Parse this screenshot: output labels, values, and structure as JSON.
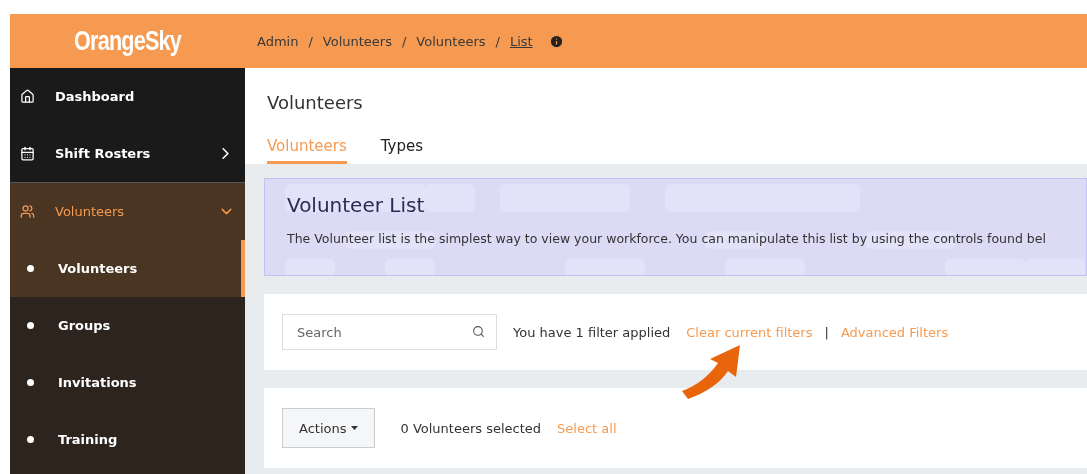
{
  "header": {
    "logo": "OrangeSky",
    "breadcrumbs": [
      {
        "label": "Admin",
        "current": false
      },
      {
        "label": "Volunteers",
        "current": false
      },
      {
        "label": "Volunteers",
        "current": false
      },
      {
        "label": "List",
        "current": true
      }
    ],
    "separator": "/"
  },
  "sidebar": {
    "items": [
      {
        "label": "Dashboard"
      },
      {
        "label": "Shift Rosters",
        "expanded": false
      },
      {
        "label": "Volunteers",
        "expanded": true,
        "children": [
          {
            "label": "Volunteers",
            "selected": true
          },
          {
            "label": "Groups",
            "selected": false
          },
          {
            "label": "Invitations",
            "selected": false
          },
          {
            "label": "Training",
            "selected": false
          }
        ]
      }
    ]
  },
  "page": {
    "title": "Volunteers",
    "tabs": [
      {
        "label": "Volunteers",
        "selected": true
      },
      {
        "label": "Types",
        "selected": false
      }
    ]
  },
  "banner": {
    "title": "Volunteer List",
    "text": "The Volunteer list is the simplest way to view your workforce. You can manipulate this list by using the controls found bel"
  },
  "filters": {
    "search": {
      "placeholder": "Search"
    },
    "status": "You have 1 filter applied",
    "links": [
      "Clear current filters",
      "Advanced Filters"
    ],
    "divider": "|"
  },
  "actions": {
    "button": "Actions",
    "selected_count": "0 Volunteers selected",
    "select_all": "Select all"
  }
}
